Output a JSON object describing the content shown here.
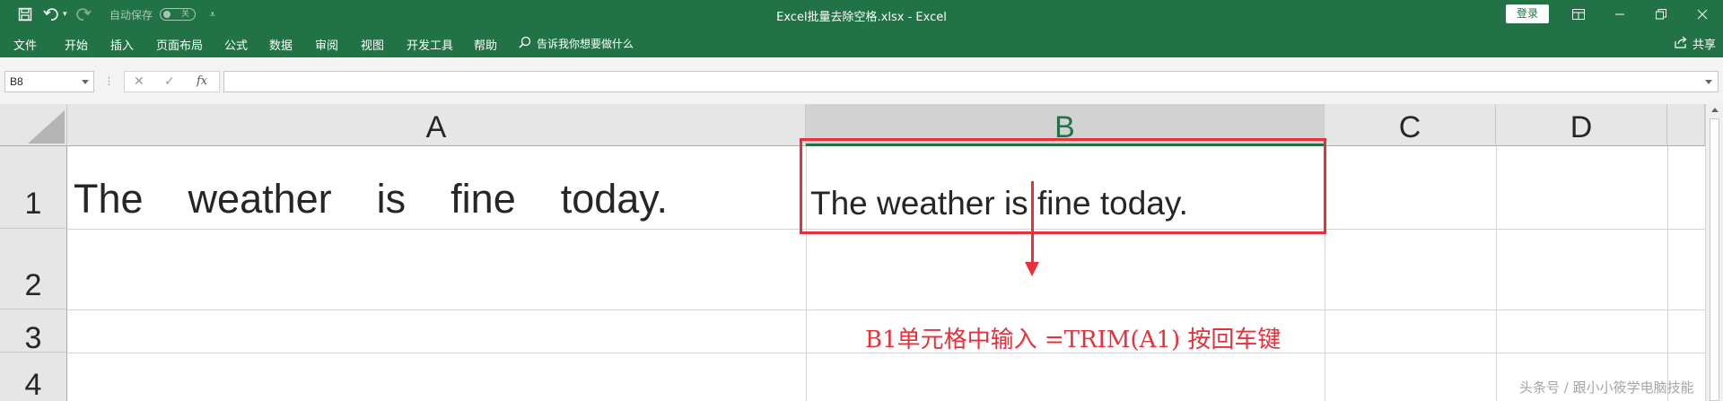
{
  "app": {
    "window_title": "Excel批量去除空格.xlsx  -  Excel",
    "autosave_label": "自动保存",
    "autosave_state": "关",
    "login_label": "登录"
  },
  "ribbon": {
    "tabs": [
      "文件",
      "开始",
      "插入",
      "页面布局",
      "公式",
      "数据",
      "审阅",
      "视图",
      "开发工具",
      "帮助"
    ],
    "tell_me": "告诉我你想要做什么",
    "share": "共享"
  },
  "formula_bar": {
    "name_box": "B8",
    "fx": "fx",
    "value": ""
  },
  "sheet": {
    "columns": [
      "A",
      "B",
      "C",
      "D"
    ],
    "selected_column": "B",
    "rows": [
      "1",
      "2",
      "3",
      "4"
    ],
    "cells": {
      "A1": "The    weather    is    fine    today.",
      "B1": "The weather is fine today."
    }
  },
  "annotation": {
    "text": "B1单元格中输入 =TRIM(A1) 按回车键",
    "color": "#e8303a"
  },
  "watermark": "头条号 / 跟小小筱学电脑技能",
  "colors": {
    "excel_green": "#217346",
    "annotation_red": "#e8303a",
    "header_gray": "#e6e6e6"
  }
}
